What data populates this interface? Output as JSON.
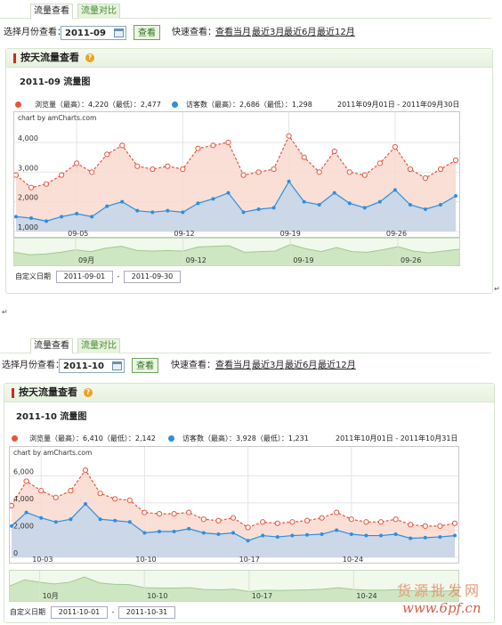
{
  "tabs": [
    "流量查看",
    "流量对比"
  ],
  "toolbar": {
    "select_label": "选择月份查看：",
    "view_button": "查看",
    "quick_label": "快速查看：",
    "quick_links": [
      "查看当月",
      "最近3月",
      "最近6月",
      "最近12月"
    ]
  },
  "card_title": "按天流量查看",
  "help_icon": "?",
  "credit": "chart by amCharts.com",
  "custom_label": "自定义日期",
  "date_separator": "-",
  "return_mark": "↵",
  "watermark": {
    "line1": "货源批发网",
    "line2": "www.6pf.cn"
  },
  "colors": {
    "views": "#e8553a",
    "visitors": "#2a90e0",
    "views_fill": "#f8d9cf",
    "visitors_fill": "#c9d6e8"
  },
  "panels": [
    {
      "month_value": "2011-09",
      "chart_title": "2011-09 流量图",
      "legend_views": "浏览量（最高）：4,220（最低）：2,477",
      "legend_visitors": "访客数（最高）：2,686（最低）：1,298",
      "range": "2011年09月01日 - 2011年09月30日",
      "start_date": "2011-09-01",
      "end_date": "2011-09-30",
      "chart_data": {
        "type": "area",
        "x": [
          "09-01",
          "09-02",
          "09-03",
          "09-04",
          "09-05",
          "09-06",
          "09-07",
          "09-08",
          "09-09",
          "09-10",
          "09-11",
          "09-12",
          "09-13",
          "09-14",
          "09-15",
          "09-16",
          "09-17",
          "09-18",
          "09-19",
          "09-20",
          "09-21",
          "09-22",
          "09-23",
          "09-24",
          "09-25",
          "09-26",
          "09-27",
          "09-28",
          "09-29",
          "09-30"
        ],
        "series": [
          {
            "name": "浏览量",
            "values": [
              2900,
              2480,
              2600,
              2900,
              3300,
              3000,
              3600,
              3900,
              3200,
              3100,
              3200,
              3100,
              3800,
              3900,
              4000,
              2900,
              3000,
              3100,
              4220,
              3500,
              3000,
              3700,
              3000,
              2900,
              3300,
              3850,
              3100,
              2800,
              3100,
              3400
            ]
          },
          {
            "name": "访客数",
            "values": [
              1500,
              1450,
              1350,
              1500,
              1600,
              1500,
              1850,
              2000,
              1700,
              1650,
              1700,
              1650,
              1950,
              2100,
              2300,
              1650,
              1750,
              1800,
              2686,
              2000,
              1900,
              2300,
              1950,
              1800,
              2000,
              2400,
              1900,
              1750,
              1900,
              2200
            ]
          }
        ],
        "x_ticks": [
          "09-05",
          "09-12",
          "09-19",
          "09-26"
        ],
        "y_ticks": [
          "1,000",
          "2,000",
          "3,000",
          "4,000"
        ],
        "ylim": [
          1000,
          4600
        ],
        "nav_labels": [
          "09月",
          "09-12",
          "09-19",
          "09-26"
        ],
        "grid": true
      }
    },
    {
      "month_value": "2011-10",
      "chart_title": "2011-10 流量图",
      "legend_views": "浏览量（最高）：6,410（最低）：2,142",
      "legend_visitors": "访客数（最高）：3,928（最低）：1,231",
      "range": "2011年10月01日 - 2011年10月31日",
      "start_date": "2011-10-01",
      "end_date": "2011-10-31",
      "chart_data": {
        "type": "area",
        "x": [
          "10-01",
          "10-02",
          "10-03",
          "10-04",
          "10-05",
          "10-06",
          "10-07",
          "10-08",
          "10-09",
          "10-10",
          "10-11",
          "10-12",
          "10-13",
          "10-14",
          "10-15",
          "10-16",
          "10-17",
          "10-18",
          "10-19",
          "10-20",
          "10-21",
          "10-22",
          "10-23",
          "10-24",
          "10-25",
          "10-26",
          "10-27",
          "10-28",
          "10-29",
          "10-30",
          "10-31"
        ],
        "series": [
          {
            "name": "浏览量",
            "values": [
              3800,
              5600,
              4900,
              4400,
              4900,
              6410,
              4700,
              4300,
              4200,
              3300,
              3200,
              3200,
              3300,
              2800,
              2700,
              2900,
              2200,
              2600,
              2500,
              2600,
              2700,
              2900,
              3300,
              2800,
              2600,
              2600,
              2800,
              2400,
              2300,
              2300,
              2500
            ]
          },
          {
            "name": "访客数",
            "values": [
              2300,
              3300,
              2900,
              2600,
              2800,
              3928,
              2800,
              2700,
              2600,
              1800,
              1900,
              1900,
              2100,
              1800,
              1700,
              1800,
              1231,
              1600,
              1500,
              1600,
              1650,
              1700,
              2000,
              1700,
              1600,
              1600,
              1700,
              1400,
              1450,
              1500,
              1600
            ]
          }
        ],
        "x_ticks": [
          "10-03",
          "10-10",
          "10-17",
          "10-24"
        ],
        "y_ticks": [
          "0",
          "2,000",
          "4,000",
          "6,000"
        ],
        "ylim": [
          0,
          7200
        ],
        "nav_labels": [
          "10月",
          "10-10",
          "10-17",
          "10-24"
        ],
        "grid": true
      }
    }
  ]
}
